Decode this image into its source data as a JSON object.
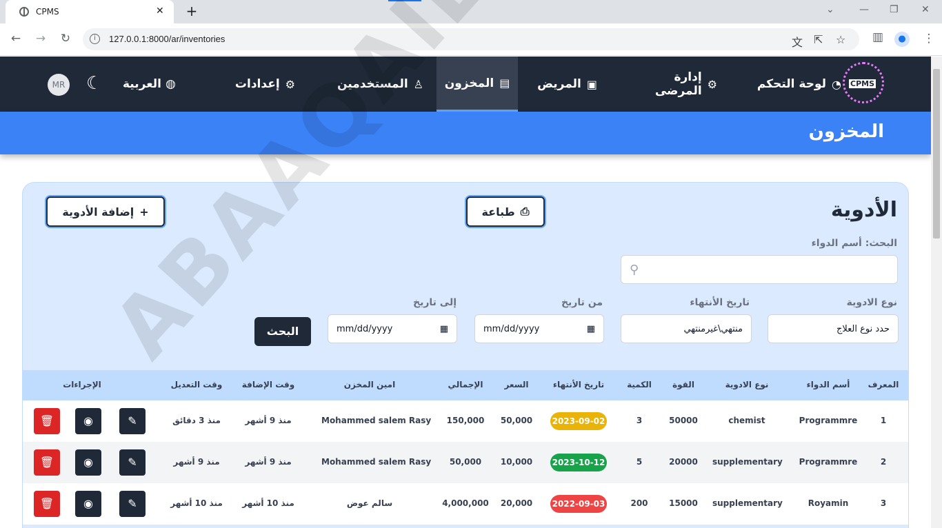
{
  "browser": {
    "tab_title": "CPMS",
    "url": "127.0.0.1:8000/ar/inventories",
    "new_tab": "+",
    "close_tab": "✕"
  },
  "nav": {
    "logo_text": "CPMS",
    "dashboard": "لوحة التحكم",
    "patients_mgmt": "إدارة المرضى",
    "patient": "المريض",
    "inventory": "المخزون",
    "users": "المستخدمين",
    "settings": "إعدادات",
    "language": "العربية",
    "avatar": "MR"
  },
  "page": {
    "header_title": "المخزون"
  },
  "card": {
    "title": "الأدوية",
    "print_label": "طباعة",
    "add_label": "إضافة الأدوية",
    "search_label": "البحث: أسم الدواء",
    "search_value": "",
    "filter_type_label": "نوع الادوية",
    "filter_type_value": "حدد نوع العلاج",
    "filter_expiry_label": "تاريخ الأنتهاء",
    "filter_expiry_value": "منتهي\\غيرمنتهي",
    "from_label": "من تاريخ",
    "to_label": "إلى تاريخ",
    "date_placeholder": "mm/dd/yyyy",
    "search_button": "البحث"
  },
  "table": {
    "headers": {
      "id": "المعرف",
      "name": "أسم الدواء",
      "type": "نوع الادوية",
      "strength": "القوة",
      "qty": "الكمية",
      "expiry": "تاريخ الأنتهاء",
      "price": "السعر",
      "total": "الإجمالي",
      "keeper": "امين المخزن",
      "added": "وقت الإضافة",
      "modified": "وقت التعديل",
      "actions": "الإجراءات"
    },
    "rows": [
      {
        "id": "1",
        "name": "Programmre",
        "type": "chemist",
        "strength": "50000",
        "qty": "3",
        "expiry": "2023-09-02",
        "expiry_color": "#eab308",
        "price": "50,000",
        "total": "150,000",
        "keeper": "Mohammed salem Rasy",
        "added": "منذ 9 أشهر",
        "modified": "منذ 3 دقائق"
      },
      {
        "id": "2",
        "name": "Programmre",
        "type": "supplementary",
        "strength": "20000",
        "qty": "5",
        "expiry": "2023-10-12",
        "expiry_color": "#16a34a",
        "price": "10,000",
        "total": "50,000",
        "keeper": "Mohammed salem Rasy",
        "added": "منذ 9 أشهر",
        "modified": "منذ 9 أشهر"
      },
      {
        "id": "3",
        "name": "Royamin",
        "type": "supplementary",
        "strength": "15000",
        "qty": "200",
        "expiry": "2022-09-03",
        "expiry_color": "#ef4444",
        "price": "20,000",
        "total": "4,000,000",
        "keeper": "سالم عوض",
        "added": "منذ 10 أشهر",
        "modified": "منذ 10 أشهر"
      }
    ]
  },
  "watermark": "ABAAQAIL"
}
